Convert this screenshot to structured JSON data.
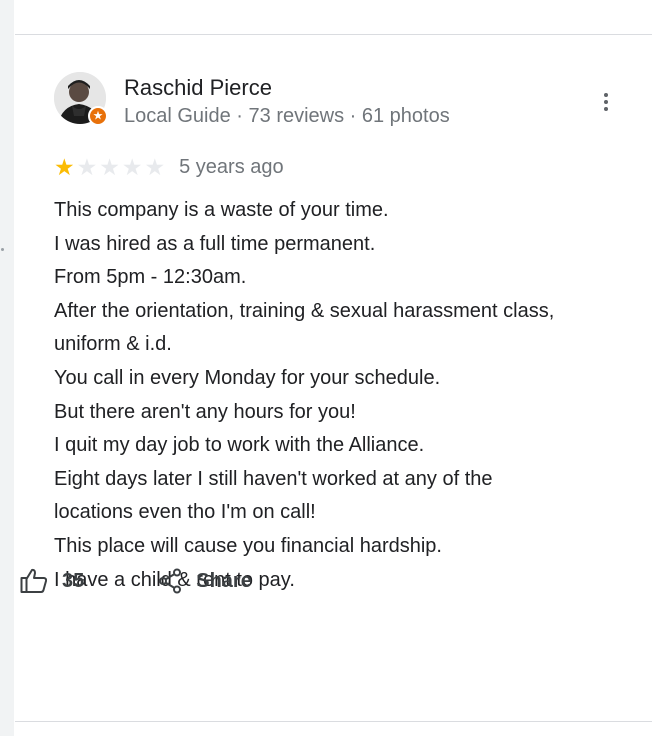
{
  "reviewer": {
    "name": "Raschid Pierce",
    "meta": "Local Guide · 73 reviews · 61 photos"
  },
  "review": {
    "rating": 1,
    "max_rating": 5,
    "date": "5 years ago",
    "lines": [
      "This company is a waste of your time.",
      "I was hired as a full time permanent.",
      "From 5pm - 12:30am.",
      "After the orientation, training & sexual harassment class,",
      "uniform & i.d.",
      "You call in every Monday for your schedule.",
      "But there aren't any hours for you!",
      "I quit my day job to work with the Alliance.",
      "Eight days later I still haven't worked at any of the",
      "locations even tho I'm on call!",
      "This place will cause you financial hardship.",
      "I have a child & rent to pay."
    ]
  },
  "actions": {
    "like_count": "35",
    "share_label": "Share"
  },
  "colors": {
    "star_filled": "#fbbc04",
    "star_empty": "#e8eaed",
    "local_guide_badge": "#e8710a"
  },
  "icons": {
    "like": "thumbs-up-icon",
    "share": "share-icon",
    "more": "more-vertical-icon",
    "badge": "local-guide-badge-icon"
  }
}
